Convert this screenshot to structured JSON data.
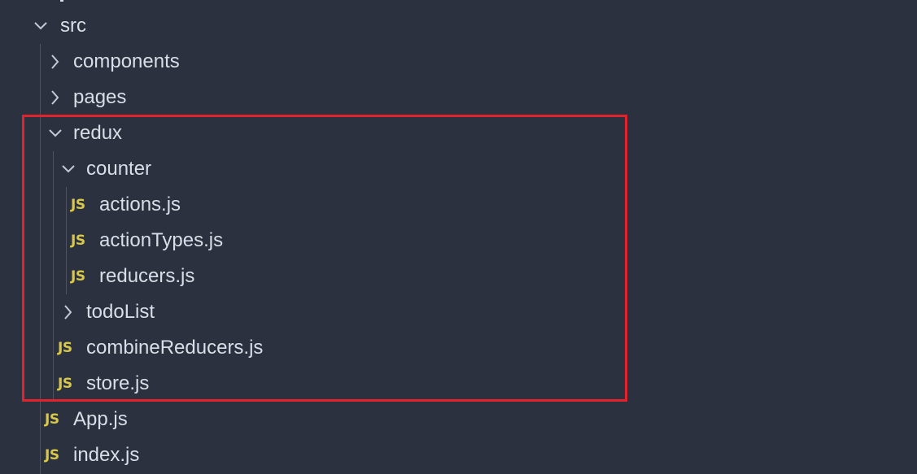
{
  "explorer": {
    "rows": [
      {
        "label": "src",
        "kind": "folder",
        "state": "expanded",
        "icon": "chevron-down-icon"
      },
      {
        "label": "components",
        "kind": "folder",
        "state": "collapsed",
        "icon": "chevron-right-icon"
      },
      {
        "label": "pages",
        "kind": "folder",
        "state": "collapsed",
        "icon": "chevron-right-icon"
      },
      {
        "label": "redux",
        "kind": "folder",
        "state": "expanded",
        "icon": "chevron-down-icon"
      },
      {
        "label": "counter",
        "kind": "folder",
        "state": "expanded",
        "icon": "chevron-down-icon"
      },
      {
        "label": "actions.js",
        "kind": "file",
        "icon_text": "JS"
      },
      {
        "label": "actionTypes.js",
        "kind": "file",
        "icon_text": "JS"
      },
      {
        "label": "reducers.js",
        "kind": "file",
        "icon_text": "JS"
      },
      {
        "label": "todoList",
        "kind": "folder",
        "state": "collapsed",
        "icon": "chevron-right-icon"
      },
      {
        "label": "combineReducers.js",
        "kind": "file",
        "icon_text": "JS"
      },
      {
        "label": "store.js",
        "kind": "file",
        "icon_text": "JS"
      },
      {
        "label": "App.js",
        "kind": "file",
        "icon_text": "JS"
      },
      {
        "label": "index.js",
        "kind": "file",
        "icon_text": "JS"
      }
    ]
  },
  "colors": {
    "background": "#2b313e",
    "text": "#d9dee7",
    "js_icon": "#d7c84c",
    "highlight_box": "#e2232b",
    "indent_guide": "#4c5466"
  }
}
